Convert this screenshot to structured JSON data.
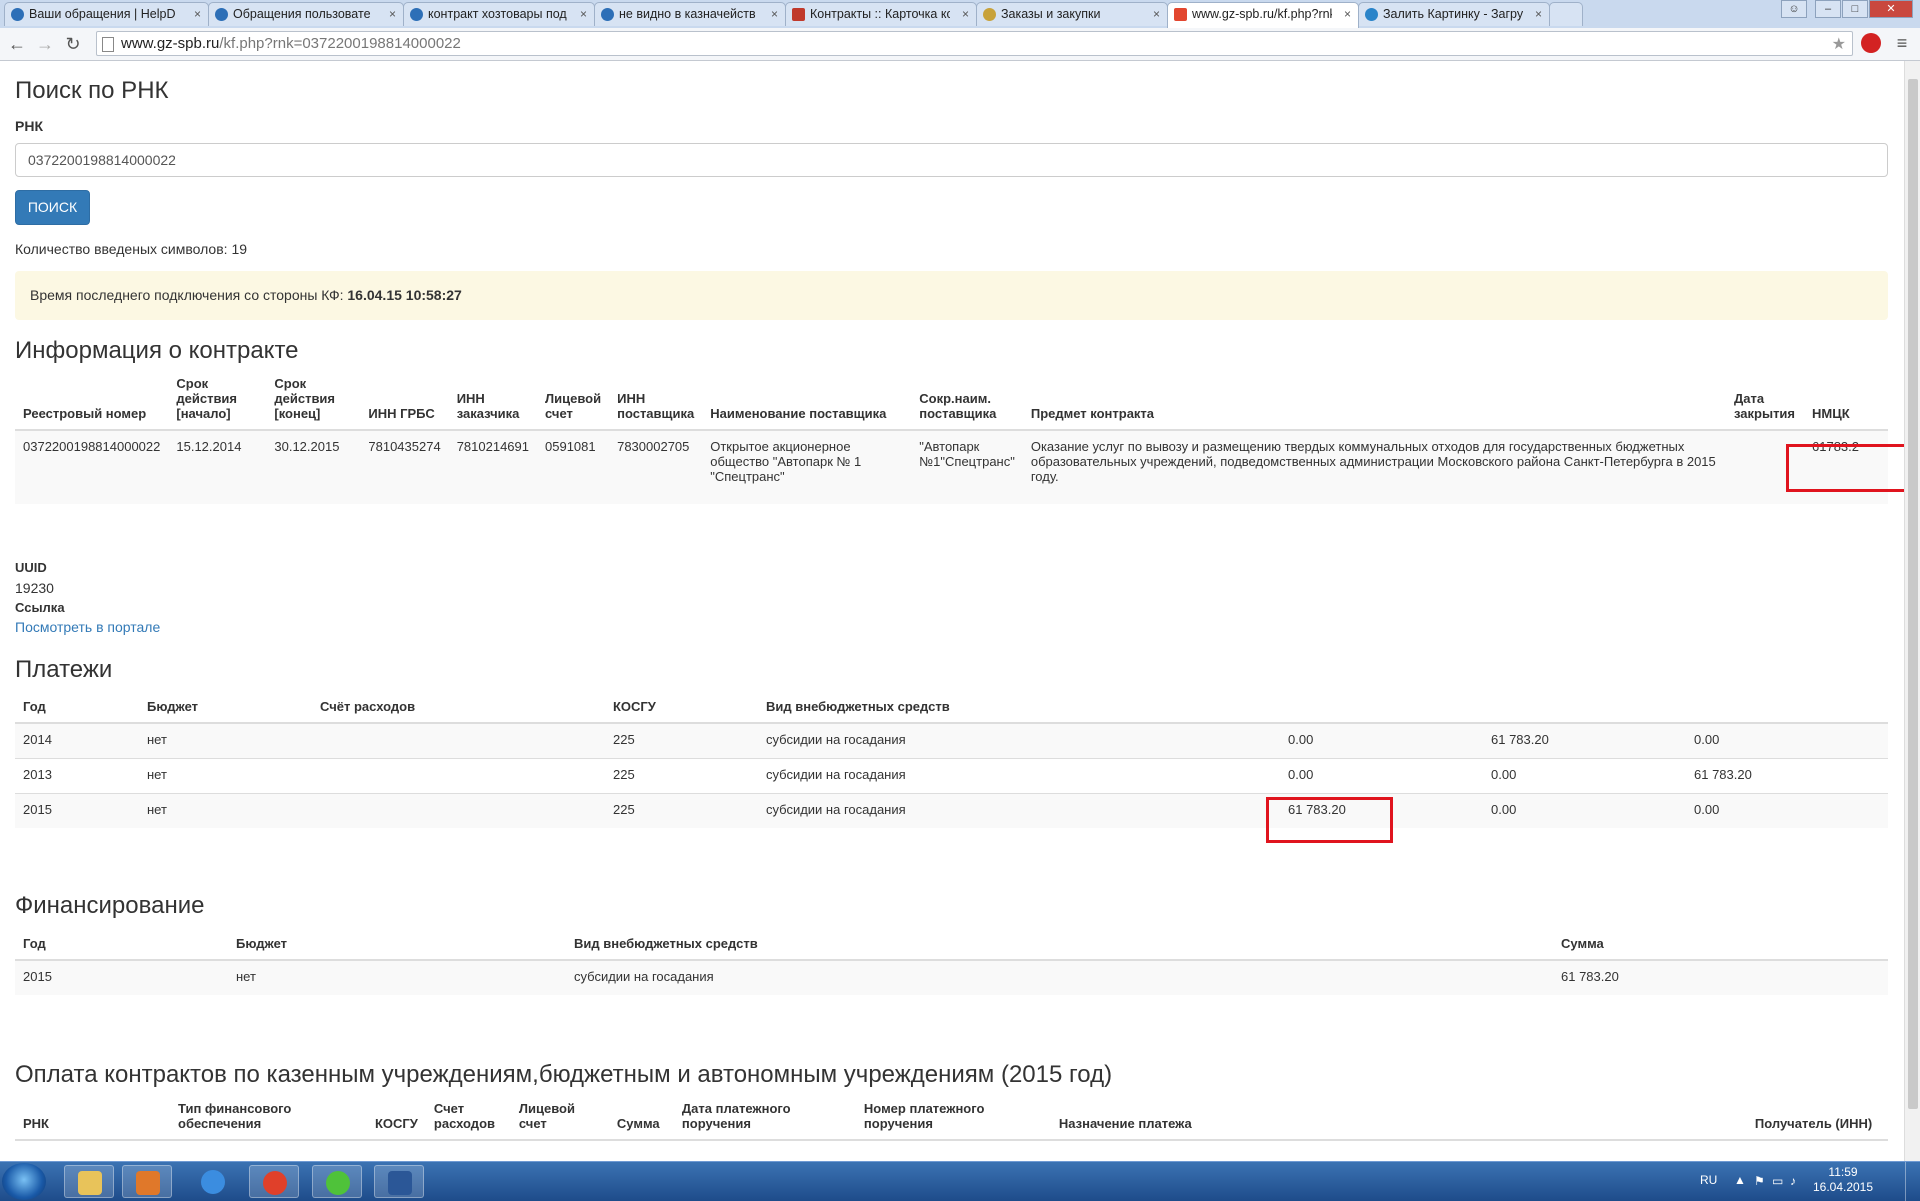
{
  "browser": {
    "tabs": [
      {
        "label": "Ваши обращения | HelpD",
        "icon": "globe-icon"
      },
      {
        "label": "Обращения пользовате",
        "icon": "globe-icon"
      },
      {
        "label": "контракт хозтовары под",
        "icon": "globe-icon"
      },
      {
        "label": "не видно в казначейств",
        "icon": "globe-icon"
      },
      {
        "label": "Контракты :: Карточка ко",
        "icon": "tools-icon"
      },
      {
        "label": "Заказы и закупки",
        "icon": "emblem-icon"
      },
      {
        "label": "www.gz-spb.ru/kf.php?rnk",
        "icon": "site-icon",
        "active": true
      },
      {
        "label": "Залить Картинку - Загруз",
        "icon": "upload-icon"
      }
    ],
    "close_glyph": "×",
    "window_controls": {
      "minimize": "–",
      "maximize": "□",
      "close": "✕",
      "user": "☺"
    },
    "nav": {
      "back": "←",
      "forward": "→",
      "reload": "↻"
    },
    "url": {
      "host": "www.gz-spb.ru",
      "path": "/kf.php?rnk=0372200198814000022"
    },
    "star": "★",
    "menu": "≡"
  },
  "search": {
    "title": "Поиск по РНК",
    "label": "РНК",
    "value": "0372200198814000022",
    "button": "ПОИСК",
    "count_text": "Количество введеных символов: 19"
  },
  "alert": {
    "text": "Время последнего подключения со стороны КФ: ",
    "datetime": "16.04.15 10:58:27"
  },
  "contract": {
    "title": "Информация о контракте",
    "headers": [
      "Реестровый номер",
      "Срок действия [начало]",
      "Срок действия [конец]",
      "ИНН ГРБС",
      "ИНН заказчика",
      "Лицевой счет",
      "ИНН поставщика",
      "Наименование поставщика",
      "Сокр.наим. поставщика",
      "Предмет контракта",
      "Дата закрытия",
      "НМЦК"
    ],
    "row": [
      "0372200198814000022",
      "15.12.2014",
      "30.12.2015",
      "7810435274",
      "7810214691",
      "0591081",
      "7830002705",
      "Открытое акционерное общество \"Автопарк № 1 \"Спецтранс\"",
      "\"Автопарк №1\"Спецтранс\"",
      "Оказание услуг по вывозу и размещению твердых коммунальных отходов для государственных бюджетных образовательных учреждений, подведомственных администрации Московского района Санкт-Петербурга в 2015 году.",
      "",
      "61783.2"
    ]
  },
  "uuid": {
    "label": "UUID",
    "value": "19230",
    "link_label": "Ссылка",
    "link_text": "Посмотреть в портале"
  },
  "payments": {
    "title": "Платежи",
    "headers": [
      "Год",
      "Бюджет",
      "Счёт расходов",
      "КОСГУ",
      "Вид внебюджетных средств",
      "",
      "",
      ""
    ],
    "rows": [
      [
        "2014",
        "нет",
        "",
        "225",
        "субсидии на госадания",
        "0.00",
        "61 783.20",
        "0.00"
      ],
      [
        "2013",
        "нет",
        "",
        "225",
        "субсидии на госадания",
        "0.00",
        "0.00",
        "61 783.20"
      ],
      [
        "2015",
        "нет",
        "",
        "225",
        "субсидии на госадания",
        "61 783.20",
        "0.00",
        "0.00"
      ]
    ]
  },
  "financing": {
    "title": "Финансирование",
    "headers": [
      "Год",
      "Бюджет",
      "Вид внебюджетных средств",
      "Сумма"
    ],
    "rows": [
      [
        "2015",
        "нет",
        "субсидии на госадания",
        "61 783.20"
      ]
    ]
  },
  "contract_payments": {
    "title": "Оплата контрактов по казенным учреждениям,бюджетным и автономным учреждениям (2015 год)",
    "headers": [
      "РНК",
      "Тип финансового обеспечения",
      "КОСГУ",
      "Счет расходов",
      "Лицевой счет",
      "Сумма",
      "Дата платежного поручения",
      "Номер платежного поручения",
      "Назначение платежа",
      "Получатель (ИНН)"
    ]
  },
  "taskbar": {
    "apps": [
      "explorer-icon",
      "media-player-icon",
      "ie-icon",
      "chrome-icon",
      "icq-icon",
      "word-icon"
    ],
    "app_colors": [
      "#e8c35a",
      "#e0782a",
      "#3b8de0",
      "#e0402a",
      "#4fc23a",
      "#2b5797"
    ],
    "lang": "RU",
    "up_arrow": "▲",
    "time": "11:59",
    "date": "16.04.2015"
  },
  "colors": {
    "accent": "#337ab7",
    "alert_bg": "#fcf8e3",
    "highlight": "#e0141e"
  }
}
